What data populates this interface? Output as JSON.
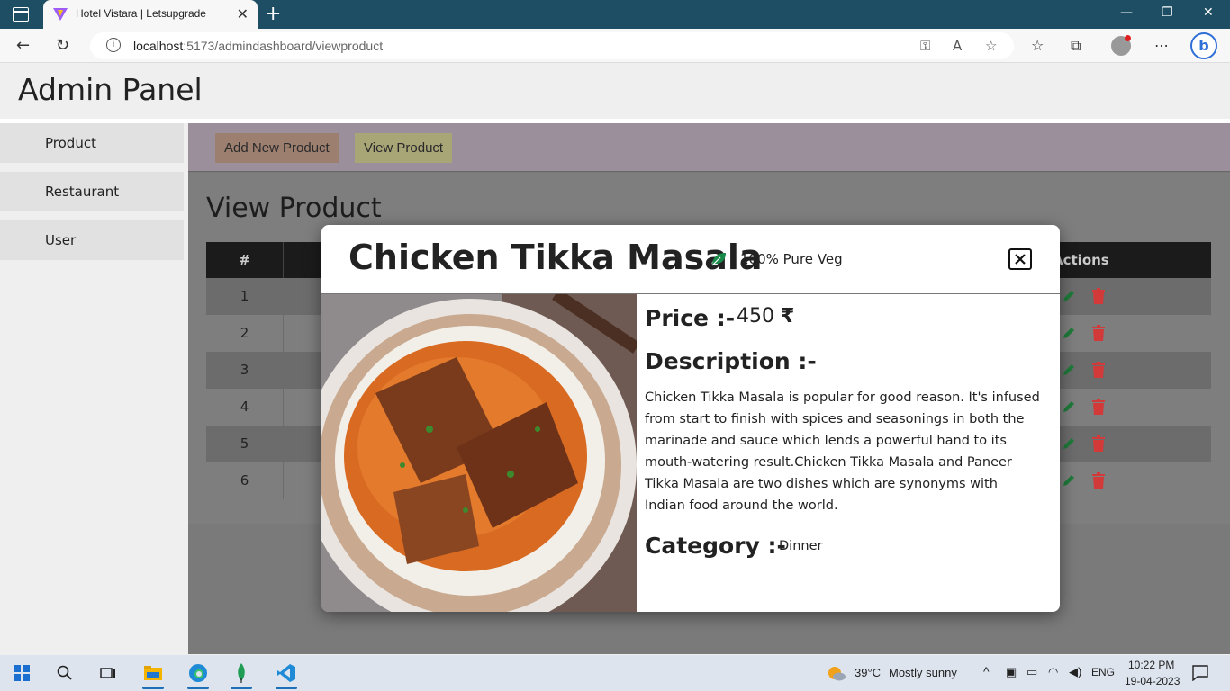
{
  "browser": {
    "tab_title": "Hotel Vistara | Letsupgrade",
    "url_host": "localhost",
    "url_rest": ":5173/admindashboard/viewproduct"
  },
  "app": {
    "title": "Admin Panel"
  },
  "sidebar": {
    "items": [
      {
        "label": "Product"
      },
      {
        "label": "Restaurant"
      },
      {
        "label": "User"
      }
    ]
  },
  "toolbar": {
    "add_label": "Add New Product",
    "view_label": "View Product"
  },
  "page": {
    "heading": "View Product",
    "table": {
      "col_hash": "#",
      "col_actions": "Actions",
      "rows": [
        "1",
        "2",
        "3",
        "4",
        "5",
        "6"
      ]
    }
  },
  "modal": {
    "title": "Chicken Tikka Masala",
    "veg_label": "100% Pure Veg",
    "price_label": "Price :-",
    "price_value": "450",
    "currency": "₹",
    "description_label": "Description :-",
    "description": "Chicken Tikka Masala is popular for good reason. It's infused from start to finish with spices and seasonings in both the marinade and sauce which lends a powerful hand to its mouth-watering result.Chicken Tikka Masala and Paneer Tikka Masala are two dishes which are synonyms with Indian food around the world.",
    "category_label": "Category :-",
    "category_value": "Dinner"
  },
  "taskbar": {
    "temperature": "39°C",
    "weather": "Mostly sunny",
    "language": "ENG",
    "time": "10:22 PM",
    "date": "19-04-2023"
  },
  "colors": {
    "tabbar": "#1e4e63",
    "edit_icon": "#1f7a3a",
    "delete_icon": "#d23a3a",
    "veg_leaf": "#1a8a4a"
  }
}
